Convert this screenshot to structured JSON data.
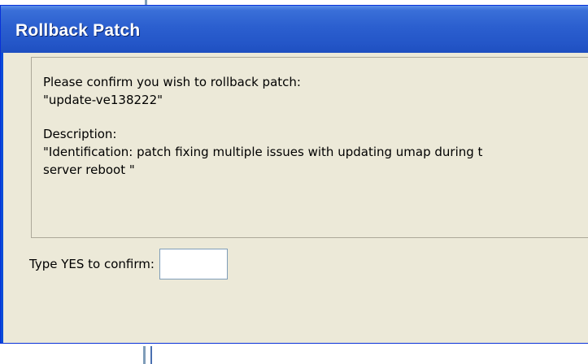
{
  "dialog": {
    "title": "Rollback Patch",
    "message": {
      "prompt_line1": "Please confirm you wish to rollback patch:",
      "patch_name": "\"update-ve138222\"",
      "description_label": "Description:",
      "description_line1": "\"Identification: patch fixing multiple issues with updating umap during t",
      "description_line2": "server reboot \""
    },
    "confirm": {
      "label": "Type YES to confirm:",
      "value": ""
    }
  },
  "colors": {
    "titlebar": "#2456c8",
    "dialog_background": "#ece9d8",
    "input_border": "#7f9db9"
  }
}
